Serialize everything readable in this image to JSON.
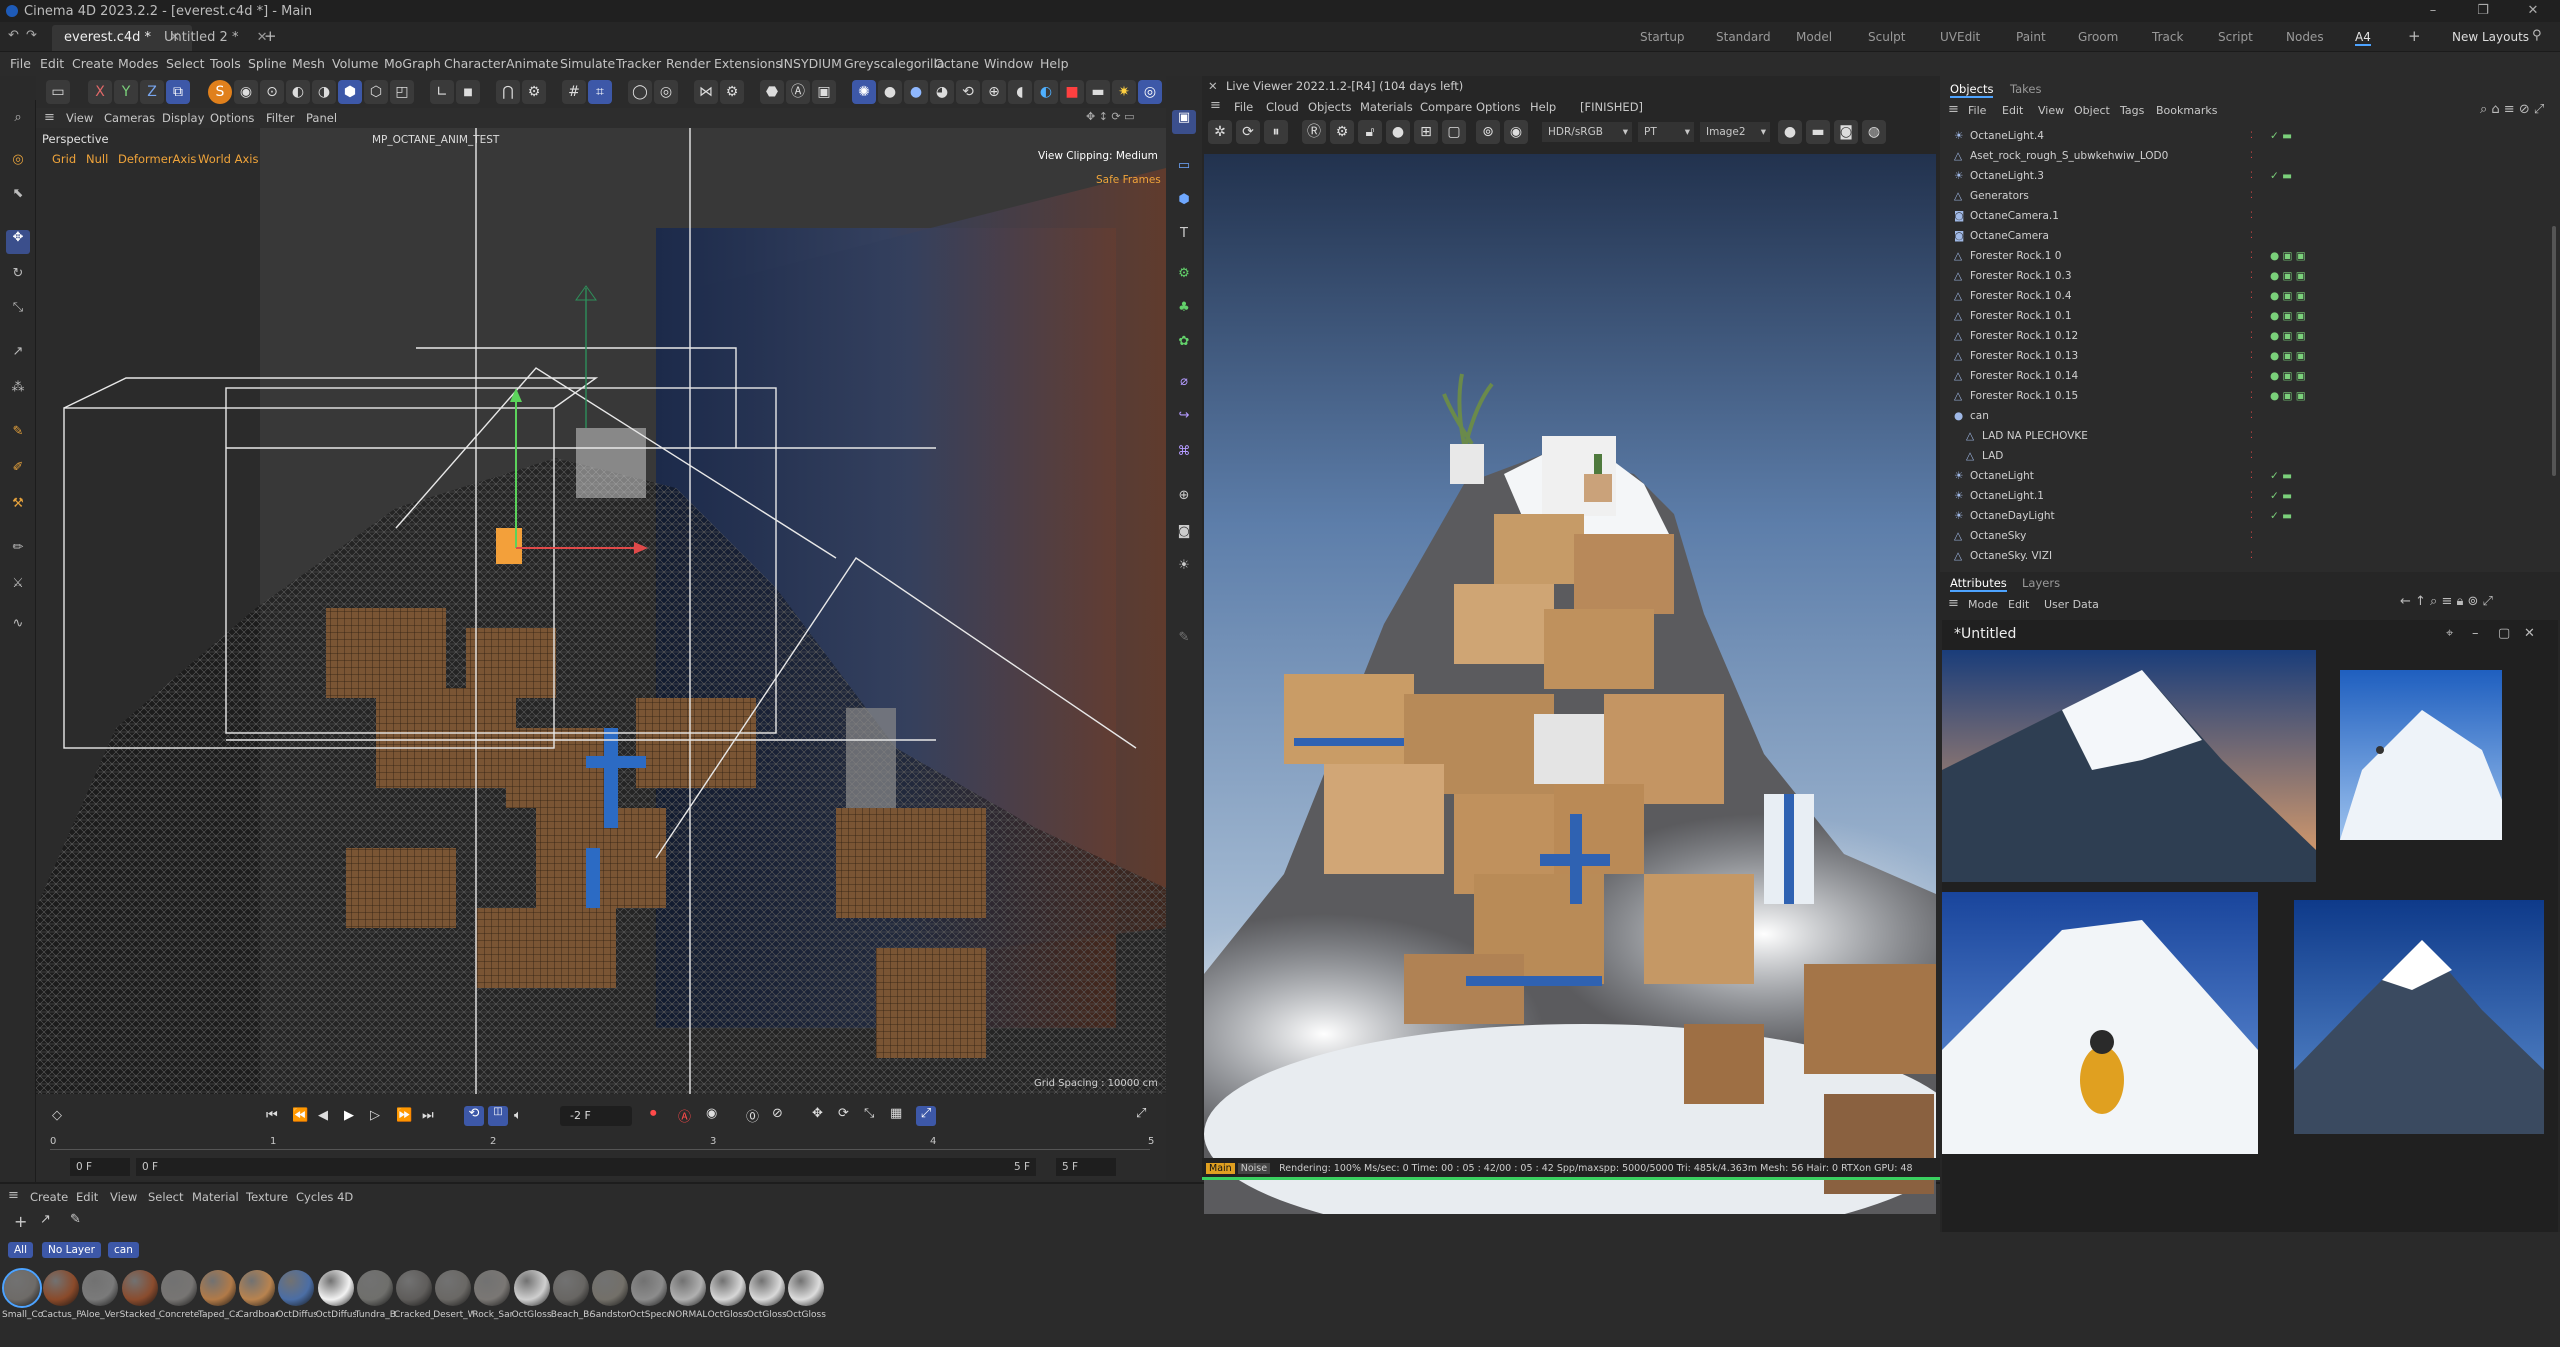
{
  "titlebar": {
    "title": "Cinema 4D 2023.2.2 - [everest.c4d *] - Main"
  },
  "docbar": {
    "tabs": [
      "everest.c4d *",
      "Untitled 2 *"
    ],
    "layouts": [
      "Startup",
      "Standard",
      "Model",
      "Sculpt",
      "UVEdit",
      "Paint",
      "Groom",
      "Track",
      "Script",
      "Nodes",
      "A4"
    ],
    "active_layout": "A4",
    "new_layouts": "New Layouts"
  },
  "menu": [
    "File",
    "Edit",
    "Create",
    "Modes",
    "Select",
    "Tools",
    "Spline",
    "Mesh",
    "Volume",
    "MoGraph",
    "Character",
    "Animate",
    "Simulate",
    "Tracker",
    "Render",
    "Extensions",
    "INSYDIUM",
    "Greyscalegorilla",
    "Octane",
    "Window",
    "Help"
  ],
  "viewport": {
    "menu": [
      "View",
      "Cameras",
      "Display",
      "Options",
      "Filter",
      "Panel"
    ],
    "camera": "Perspective",
    "hud_items": [
      "Grid",
      "Null",
      "DeformerAxis",
      "World Axis"
    ],
    "scene_name": "MP_OCTANE_ANIM_TEST",
    "clipping": "View Clipping: Medium",
    "safe_frames": "Safe Frames",
    "grid_spacing": "Grid Spacing : 10000 cm"
  },
  "timeline": {
    "current_frame": "-2 F",
    "start": "0 F",
    "start2": "0 F",
    "end": "5 F",
    "end2": "5 F",
    "ticks": [
      "0",
      "1",
      "2",
      "3",
      "4",
      "5"
    ]
  },
  "materials": {
    "menu": [
      "Create",
      "Edit",
      "View",
      "Select",
      "Material",
      "Texture",
      "Cycles 4D"
    ],
    "filters": [
      "All",
      "No Layer",
      "can"
    ],
    "items": [
      {
        "name": "Small_Conc",
        "color": "#6e6b68"
      },
      {
        "name": "Cactus_Pot",
        "color": "#8a4a2a"
      },
      {
        "name": "Aloe_Vera_s",
        "color": "#7a7a7a"
      },
      {
        "name": "Stacked_Bri",
        "color": "#8a4c2e"
      },
      {
        "name": "Concrete_Pl",
        "color": "#777573"
      },
      {
        "name": "Taped_Card",
        "color": "#b17a48"
      },
      {
        "name": "Cardboard_",
        "color": "#b8834f"
      },
      {
        "name": "OctDiffuse2",
        "color": "#4b6ea5"
      },
      {
        "name": "OctDiffuse1",
        "color": "#f2f2f2"
      },
      {
        "name": "Tundra_Bou",
        "color": "#6f6f6c"
      },
      {
        "name": "Cracked_Nc",
        "color": "#5f5d5b"
      },
      {
        "name": "Desert_Wes",
        "color": "#6a6865"
      },
      {
        "name": "Rock_Sands",
        "color": "#7a7774"
      },
      {
        "name": "OctGlossy1.",
        "color": "#cfcfcf"
      },
      {
        "name": "Beach_Boul",
        "color": "#686663"
      },
      {
        "name": "Sandstone_",
        "color": "#737069"
      },
      {
        "name": "OctSpecula",
        "color": "#8c8c8c"
      },
      {
        "name": "NORMAL",
        "color": "#b0b0b0"
      },
      {
        "name": "OctGlossy1.",
        "color": "#d6d6d6"
      },
      {
        "name": "OctGlossy1.",
        "color": "#d9d9d9"
      },
      {
        "name": "OctGlossy1.",
        "color": "#dcdcdc"
      }
    ]
  },
  "live_viewer": {
    "title": "Live Viewer 2022.1.2-[R4] (104 days left)",
    "menu": [
      "File",
      "Cloud",
      "Objects",
      "Materials",
      "Compare",
      "Options",
      "Help",
      "[FINISHED]"
    ],
    "color_space": "HDR/sRGB",
    "kernel": "PT",
    "image": "Image2",
    "status_tags": [
      "Main",
      "Noise"
    ],
    "status": "Rendering: 100%  Ms/sec: 0    Time: 00 : 05 : 42/00 : 05 : 42   Spp/maxspp: 5000/5000    Tri: 485k/4.363m   Mesh: 56    Hair: 0    RTXon       GPU:    48"
  },
  "objects": {
    "tabs": [
      "Objects",
      "Takes"
    ],
    "menu": [
      "File",
      "Edit",
      "View",
      "Object",
      "Tags",
      "Bookmarks"
    ],
    "rows": [
      {
        "name": "OctaneLight.4",
        "indent": 0
      },
      {
        "name": "Aset_rock_rough_S_ubwkehwiw_LOD0",
        "indent": 0
      },
      {
        "name": "OctaneLight.3",
        "indent": 0
      },
      {
        "name": "Generators",
        "indent": 0
      },
      {
        "name": "OctaneCamera.1",
        "indent": 0
      },
      {
        "name": "OctaneCamera",
        "indent": 0
      },
      {
        "name": "Forester Rock.1 0",
        "indent": 0
      },
      {
        "name": "Forester Rock.1 0.3",
        "indent": 0
      },
      {
        "name": "Forester Rock.1 0.4",
        "indent": 0
      },
      {
        "name": "Forester Rock.1 0.1",
        "indent": 0
      },
      {
        "name": "Forester Rock.1 0.12",
        "indent": 0
      },
      {
        "name": "Forester Rock.1 0.13",
        "indent": 0
      },
      {
        "name": "Forester Rock.1 0.14",
        "indent": 0
      },
      {
        "name": "Forester Rock.1 0.15",
        "indent": 0
      },
      {
        "name": "can",
        "indent": 0
      },
      {
        "name": "LAD NA PLECHOVKE",
        "indent": 1
      },
      {
        "name": "LAD",
        "indent": 1
      },
      {
        "name": "OctaneLight",
        "indent": 0
      },
      {
        "name": "OctaneLight.1",
        "indent": 0
      },
      {
        "name": "OctaneDayLight",
        "indent": 0
      },
      {
        "name": "OctaneSky",
        "indent": 0
      },
      {
        "name": "OctaneSky. VIZI",
        "indent": 0
      }
    ]
  },
  "attributes": {
    "tabs": [
      "Attributes",
      "Layers"
    ],
    "menu": [
      "Mode",
      "Edit",
      "User Data"
    ],
    "window_title": "*Untitled"
  }
}
